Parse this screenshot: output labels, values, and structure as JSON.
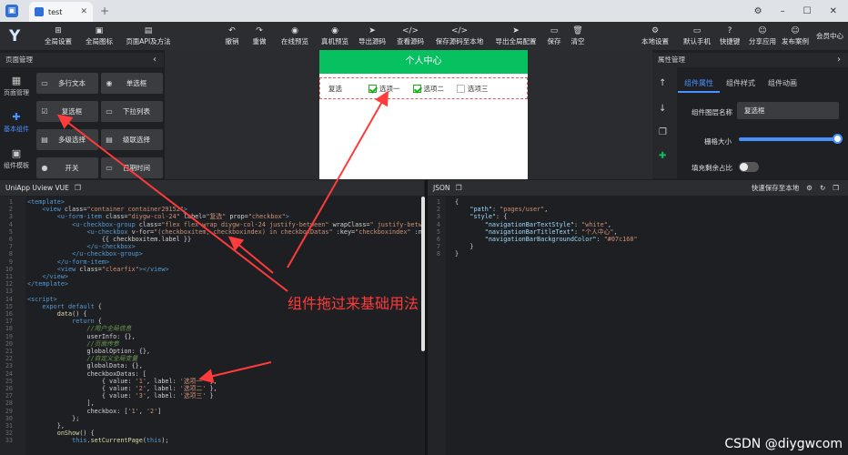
{
  "window": {
    "tab_title": "test",
    "tab_close": "✕",
    "new_tab": "+",
    "controls": [
      "⚙",
      "–",
      "☐",
      "✕"
    ]
  },
  "toolbar": {
    "logo": "Y",
    "left": [
      {
        "icon": "⊞",
        "label": "全局设置"
      },
      {
        "icon": "▣",
        "label": "全局图标"
      },
      {
        "icon": "▤",
        "label": "页面API及方法"
      }
    ],
    "center": [
      {
        "icon": "↶",
        "label": "撤销"
      },
      {
        "icon": "↷",
        "label": "重做"
      },
      {
        "icon": "◉",
        "label": "在线预览"
      },
      {
        "icon": "◉",
        "label": "真机预览"
      },
      {
        "icon": "➤",
        "label": "导出源码"
      },
      {
        "icon": "</>",
        "label": "查看源码"
      },
      {
        "icon": "</>",
        "label": "保存源码至本地"
      },
      {
        "icon": "➤",
        "label": "导出全局配置"
      },
      {
        "icon": "▭",
        "label": "保存"
      },
      {
        "icon": "🗑",
        "label": "清空"
      }
    ],
    "right": [
      {
        "icon": "⚙",
        "label": "本地设置"
      },
      {
        "icon": "▭",
        "label": "默认手机"
      },
      {
        "icon": "?",
        "label": "快捷键"
      },
      {
        "icon": "☺",
        "label": "分享应用"
      },
      {
        "icon": "☺",
        "label": "发布案例"
      }
    ],
    "member": "会员中心"
  },
  "left_panel": {
    "title": "页面管理",
    "collapse": "‹",
    "rail": [
      {
        "icon": "▦",
        "label": "页面管理"
      },
      {
        "icon": "✚",
        "label": "基本组件"
      },
      {
        "icon": "▣",
        "label": "组件模板"
      }
    ],
    "components": [
      {
        "icon": "▭",
        "label": "多行文本"
      },
      {
        "icon": "◉",
        "label": "单选框"
      },
      {
        "icon": "☑",
        "label": "复选框"
      },
      {
        "icon": "▭",
        "label": "下拉列表"
      },
      {
        "icon": "▤",
        "label": "多级选择"
      },
      {
        "icon": "▤",
        "label": "级联选择"
      },
      {
        "icon": "●",
        "label": "开关"
      },
      {
        "icon": "▭",
        "label": "日期时间"
      }
    ]
  },
  "phone": {
    "header": "个人中心",
    "form_label": "复选",
    "options": [
      {
        "label": "选项一",
        "checked": true
      },
      {
        "label": "选项二",
        "checked": true
      },
      {
        "label": "选项三",
        "checked": false
      }
    ]
  },
  "right_panel": {
    "title": "属性管理",
    "expand": "›",
    "tabs": [
      "组件属性",
      "组件样式",
      "组件动画"
    ],
    "rail_icons": [
      "↑",
      "↓",
      "❐",
      "✚"
    ],
    "name_label": "组件图层名称",
    "name_value": "复选框",
    "grid_label": "栅格大小",
    "grid_value": 1,
    "fill_label": "填充剩余占比",
    "fill_on": false
  },
  "vue_editor": {
    "title": "UniApp Uview VUE",
    "lines": [
      {
        "n": "1",
        "html": "<span class=\"tag\">&lt;template&gt;</span>"
      },
      {
        "n": "2",
        "html": "    <span class=\"tag\">&lt;view</span> class=<span class=\"str\">\"container container29152\"</span><span class=\"tag\">&gt;</span>"
      },
      {
        "n": "3",
        "html": "        <span class=\"tag\">&lt;u-form-item</span> class=<span class=\"str\">\"diygw-col-24\"</span> label=<span class=\"str\">\"复选\"</span> prop=<span class=\"str\">\"checkbox\"</span><span class=\"tag\">&gt;</span>"
      },
      {
        "n": "4",
        "html": "            <span class=\"tag\">&lt;u-checkbox-group</span> class=<span class=\"str\">\"flex flex-wrap diygw-col-24 justify-between\"</span> wrapClass=<span class=\"str\">\" justify-betwee</span>"
      },
      {
        "n": "5",
        "html": "                <span class=\"tag\">&lt;u-checkbox</span> v-for=<span class=\"str\">\"(checkboxitem, checkboxindex) in checkboxDatas\"</span> :key=<span class=\"str\">\"checkboxindex\"</span> :nam"
      },
      {
        "n": "6",
        "html": "                    {{ checkboxitem.label }}"
      },
      {
        "n": "7",
        "html": "                <span class=\"tag\">&lt;/u-checkbox&gt;</span>"
      },
      {
        "n": "8",
        "html": "            <span class=\"tag\">&lt;/u-checkbox-group&gt;</span>"
      },
      {
        "n": "9",
        "html": "        <span class=\"tag\">&lt;/u-form-item&gt;</span>"
      },
      {
        "n": "10",
        "html": "        <span class=\"tag\">&lt;view</span> class=<span class=\"str\">\"clearfix\"</span><span class=\"tag\">&gt;&lt;/view&gt;</span>"
      },
      {
        "n": "11",
        "html": "    <span class=\"tag\">&lt;/view&gt;</span>"
      },
      {
        "n": "12",
        "html": "<span class=\"tag\">&lt;/template&gt;</span>"
      },
      {
        "n": "13",
        "html": ""
      },
      {
        "n": "14",
        "html": "<span class=\"tag\">&lt;script&gt;</span>"
      },
      {
        "n": "15",
        "html": "    <span class=\"kw\">export default</span> {"
      },
      {
        "n": "16",
        "html": "        <span class=\"fn\">data</span>() {"
      },
      {
        "n": "17",
        "html": "            <span class=\"kw\">return</span> {"
      },
      {
        "n": "18",
        "html": "                <span class=\"cm\">//用户全局信息</span>"
      },
      {
        "n": "19",
        "html": "                userInfo: {},"
      },
      {
        "n": "20",
        "html": "                <span class=\"cm\">//页面传参</span>"
      },
      {
        "n": "21",
        "html": "                globalOption: {},"
      },
      {
        "n": "22",
        "html": "                <span class=\"cm\">//自定义全局变量</span>"
      },
      {
        "n": "23",
        "html": "                globalData: {},"
      },
      {
        "n": "24",
        "html": "                checkboxDatas: ["
      },
      {
        "n": "25",
        "html": "                    { value: <span class=\"str\">'1'</span>, label: <span class=\"str\">'选项一'</span> },"
      },
      {
        "n": "26",
        "html": "                    { value: <span class=\"str\">'2'</span>, label: <span class=\"str\">'选项二'</span> },"
      },
      {
        "n": "27",
        "html": "                    { value: <span class=\"str\">'3'</span>, label: <span class=\"str\">'选项三'</span> }"
      },
      {
        "n": "28",
        "html": "                ],"
      },
      {
        "n": "29",
        "html": "                checkbox: [<span class=\"str\">'1'</span>, <span class=\"str\">'2'</span>]"
      },
      {
        "n": "30",
        "html": "            };"
      },
      {
        "n": "31",
        "html": "        },"
      },
      {
        "n": "32",
        "html": "        <span class=\"fn\">onShow</span>() {"
      },
      {
        "n": "33",
        "html": "            <span class=\"kw\">this</span>.<span class=\"fn\">setCurrentPage</span>(<span class=\"kw\">this</span>);"
      }
    ]
  },
  "json_editor": {
    "title": "JSON",
    "save_label": "快速保存至本地",
    "lines": [
      {
        "n": "1",
        "html": "{"
      },
      {
        "n": "2",
        "html": "    <span class=\"json-key\">\"path\"</span>: <span class=\"json-str\">\"pages/user\"</span>,"
      },
      {
        "n": "3",
        "html": "    <span class=\"json-key\">\"style\"</span>: {"
      },
      {
        "n": "4",
        "html": "        <span class=\"json-key\">\"navigationBarTextStyle\"</span>: <span class=\"json-str\">\"white\"</span>,"
      },
      {
        "n": "5",
        "html": "        <span class=\"json-key\">\"navigationBarTitleText\"</span>: <span class=\"json-str\">\"个人中心\"</span>,"
      },
      {
        "n": "6",
        "html": "        <span class=\"json-key\">\"navigationBarBackgroundColor\"</span>: <span class=\"json-str\">\"#07c160\"</span>"
      },
      {
        "n": "7",
        "html": "    }"
      },
      {
        "n": "8",
        "html": "}"
      }
    ]
  },
  "annotation": "组件拖过来基础用法",
  "watermark": "CSDN @diygwcom",
  "colors": {
    "accent": "#4a90ff",
    "phone_header": "#07c160",
    "arrow": "#ff3b3b"
  }
}
